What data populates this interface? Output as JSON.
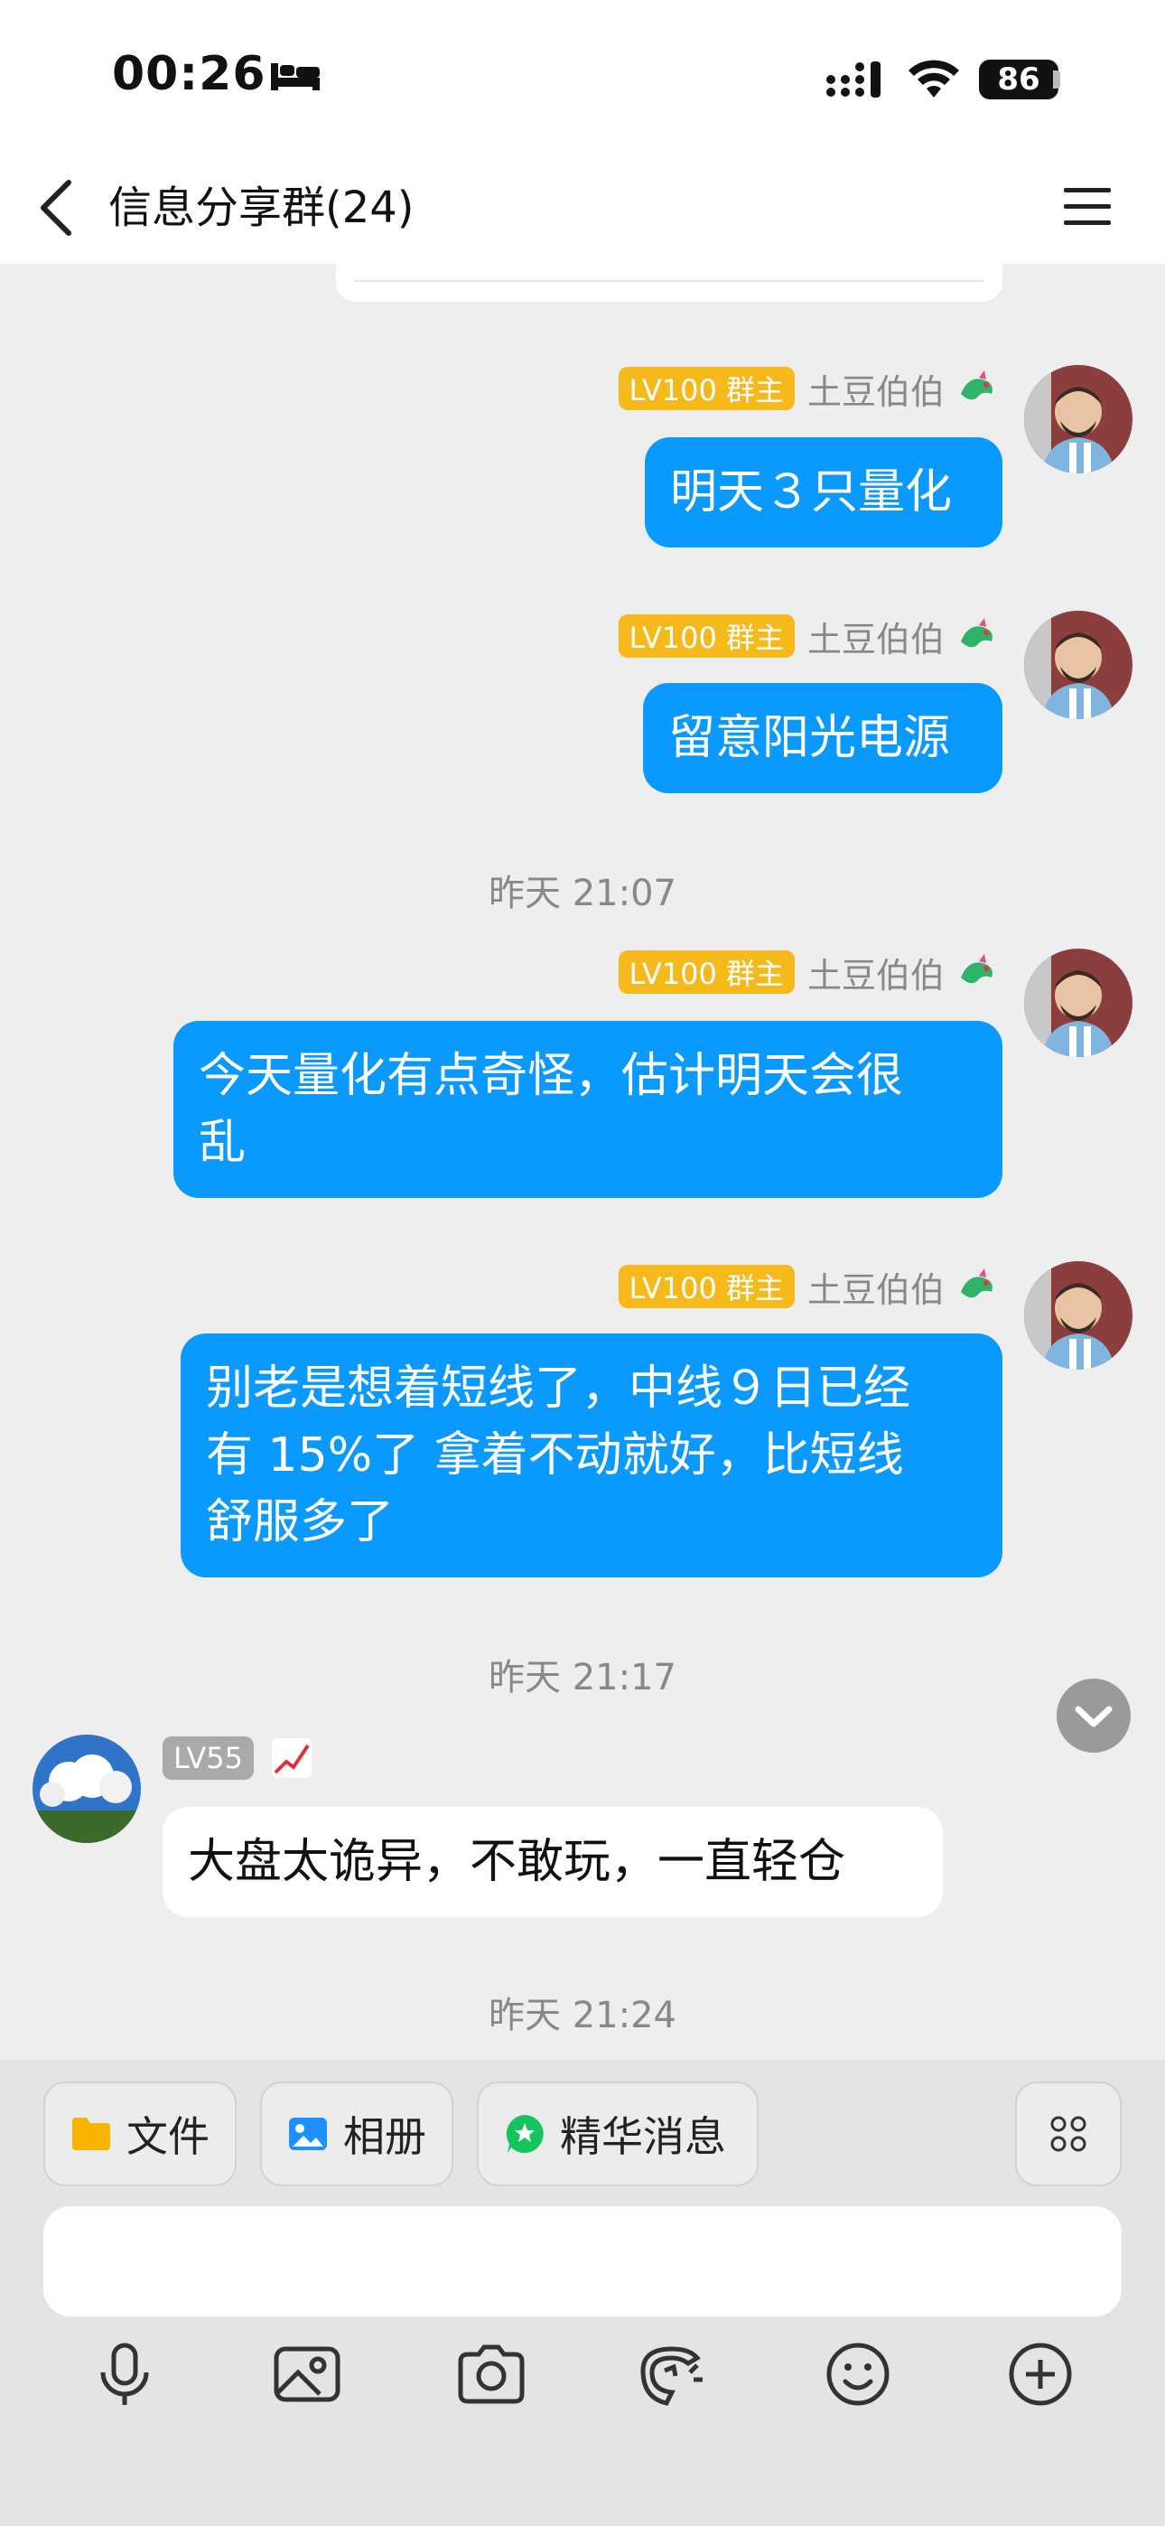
{
  "status_bar": {
    "time": "00:26",
    "battery": "86"
  },
  "header": {
    "title": "信息分享群(24)"
  },
  "messages": [
    {
      "badge": "LV100 群主",
      "sender": "土豆伯伯",
      "text": "明天３只量化"
    },
    {
      "badge": "LV100 群主",
      "sender": "土豆伯伯",
      "text": "留意阳光电源"
    },
    {
      "badge": "LV100 群主",
      "sender": "土豆伯伯",
      "text_lines": [
        "今天量化有点奇怪，估计明天会很",
        "乱"
      ]
    },
    {
      "badge": "LV100 群主",
      "sender": "土豆伯伯",
      "text_lines": [
        "别老是想着短线了，中线９日已经",
        "有 15%了 拿着不动就好，比短线",
        "舒服多了"
      ]
    },
    {
      "badge": "LV55",
      "sender": "",
      "text": "大盘太诡异，不敢玩，一直轻仓"
    }
  ],
  "timestamps": [
    "昨天 21:07",
    "昨天 21:17",
    "昨天 21:24"
  ],
  "quick_actions": [
    {
      "label": "文件",
      "icon": "folder-icon",
      "color": "#f7b500"
    },
    {
      "label": "相册",
      "icon": "photo-icon",
      "color": "#1e90ff"
    },
    {
      "label": "精华消息",
      "icon": "star-bubble-icon",
      "color": "#14c45c"
    }
  ],
  "input": {
    "placeholder": ""
  },
  "toolbar": [
    "mic-icon",
    "image-icon",
    "camera-icon",
    "sticker-icon",
    "emoji-icon",
    "plus-icon"
  ],
  "colors": {
    "bubble_blue": "#0a99ff",
    "badge_gold": "#f5b91c",
    "badge_gray": "#a9a9a9"
  }
}
